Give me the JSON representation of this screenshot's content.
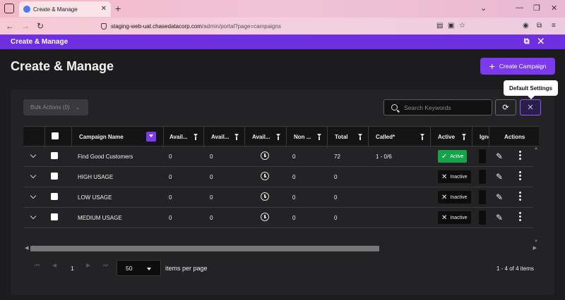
{
  "browser": {
    "tab_title": "Create & Manage",
    "url_host": "staging-web-uat.chasedatacorp.com",
    "url_path": "/admin/portal?page=campaigns"
  },
  "app_header": {
    "title": "Create & Manage"
  },
  "page": {
    "title": "Create & Manage",
    "create_button": "Create Campaign"
  },
  "toolbar": {
    "bulk_actions": "Bulk Actions (0)",
    "search_placeholder": "Search Keywords",
    "tooltip": "Default Settings"
  },
  "table": {
    "columns": [
      "Campaign Name",
      "Avail...",
      "Avail...",
      "Avail...",
      "Non ...",
      "Total",
      "Called*",
      "Active",
      "Igno",
      "Actions"
    ],
    "rows": [
      {
        "name": "Find Good Customers",
        "avail1": "0",
        "avail2": "0",
        "non": "0",
        "total": "72",
        "called": "1 - 0/6",
        "status": "Active"
      },
      {
        "name": "HIGH USAGE",
        "avail1": "0",
        "avail2": "0",
        "non": "0",
        "total": "0",
        "called": "",
        "status": "Inactive"
      },
      {
        "name": "LOW USAGE",
        "avail1": "0",
        "avail2": "0",
        "non": "0",
        "total": "0",
        "called": "",
        "status": "Inactive"
      },
      {
        "name": "MEDIUM USAGE",
        "avail1": "0",
        "avail2": "0",
        "non": "0",
        "total": "0",
        "called": "",
        "status": "Inactive"
      }
    ]
  },
  "pagination": {
    "current_page": "1",
    "page_size": "50",
    "items_per_page_label": "items per page",
    "count_label": "1 - 4 of 4 items"
  },
  "colors": {
    "accent": "#7c3aed",
    "header": "#6e2fe0",
    "active_green": "#16a34a"
  }
}
